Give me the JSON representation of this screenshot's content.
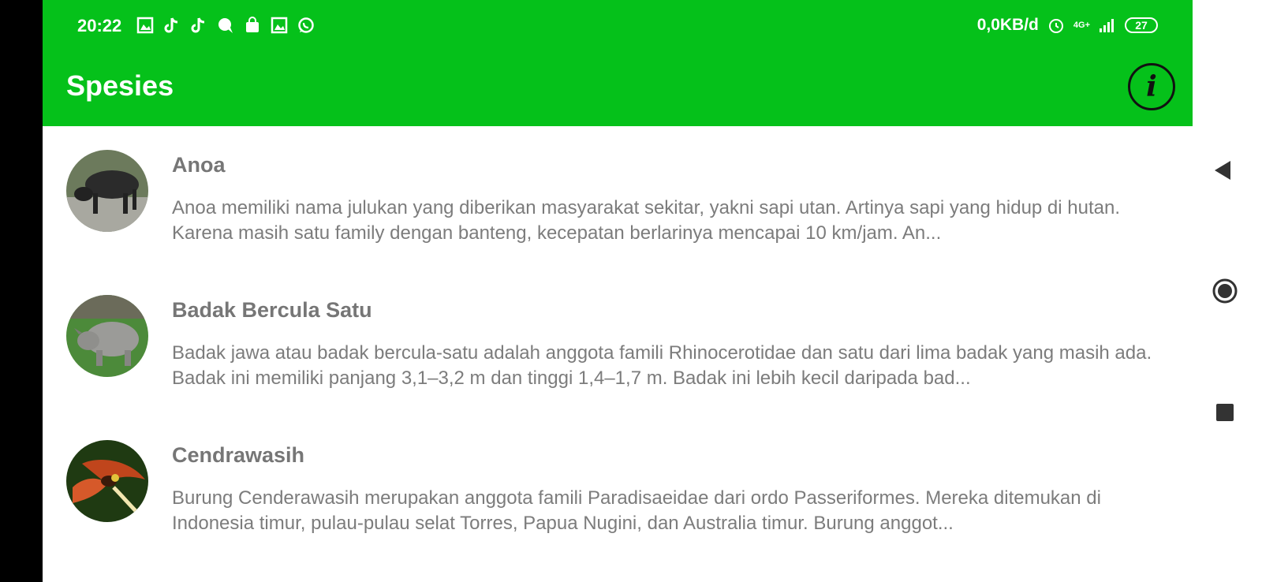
{
  "status_bar": {
    "time": "20:22",
    "net_speed": "0,0KB/d",
    "signal": "4G+",
    "battery": "27",
    "notification_icons": [
      "gallery-icon",
      "tiktok-icon",
      "tiktok-icon",
      "chat-bubble-icon",
      "shopping-bag-icon",
      "gallery-icon",
      "whatsapp-icon"
    ]
  },
  "app_bar": {
    "title": "Spesies",
    "info_button": "i",
    "color": "#05c11a"
  },
  "species": [
    {
      "name": "Anoa",
      "description": "Anoa memiliki nama julukan yang diberikan masyarakat sekitar, yakni sapi utan. Artinya sapi yang hidup di hutan. Karena masih satu family dengan banteng, kecepatan berlarinya mencapai 10 km/jam. An..."
    },
    {
      "name": "Badak Bercula Satu",
      "description": "Badak jawa atau badak bercula-satu adalah anggota famili Rhinocerotidae dan satu dari lima badak yang masih ada. Badak ini memiliki panjang 3,1–3,2 m dan tinggi 1,4–1,7 m. Badak ini lebih kecil daripada bad..."
    },
    {
      "name": "Cendrawasih",
      "description": "Burung Cenderawasih merupakan anggota famili Paradisaeidae dari ordo Passeriformes. Mereka ditemukan di Indonesia timur, pulau-pulau selat Torres, Papua Nugini, dan Australia timur. Burung anggot..."
    }
  ],
  "nav_bar": {
    "icons": [
      "back-icon",
      "home-icon",
      "recent-apps-icon"
    ]
  }
}
